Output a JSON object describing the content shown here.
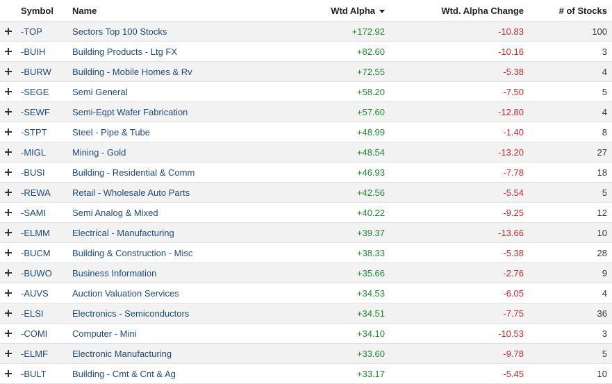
{
  "columns": {
    "symbol": "Symbol",
    "name": "Name",
    "wtd_alpha": "Wtd Alpha",
    "alpha_change": "Wtd. Alpha Change",
    "num_stocks": "# of Stocks"
  },
  "sort_icon": "sort-descending-icon",
  "colors": {
    "positive": "#1e8a2e",
    "negative": "#c62828",
    "link": "#1e4a7a",
    "row_alt": "#f2f2f2"
  },
  "rows": [
    {
      "symbol": "-TOP",
      "name": "Sectors Top 100 Stocks",
      "wtd_alpha": "+172.92",
      "alpha_change": "-10.83",
      "num_stocks": "100"
    },
    {
      "symbol": "-BUIH",
      "name": "Building Products - Ltg FX",
      "wtd_alpha": "+82.60",
      "alpha_change": "-10.16",
      "num_stocks": "3"
    },
    {
      "symbol": "-BURW",
      "name": "Building - Mobile Homes & Rv",
      "wtd_alpha": "+72.55",
      "alpha_change": "-5.38",
      "num_stocks": "4"
    },
    {
      "symbol": "-SEGE",
      "name": "Semi General",
      "wtd_alpha": "+58.20",
      "alpha_change": "-7.50",
      "num_stocks": "5"
    },
    {
      "symbol": "-SEWF",
      "name": "Semi-Eqpt Wafer Fabrication",
      "wtd_alpha": "+57.60",
      "alpha_change": "-12.80",
      "num_stocks": "4"
    },
    {
      "symbol": "-STPT",
      "name": "Steel - Pipe & Tube",
      "wtd_alpha": "+48.99",
      "alpha_change": "-1.40",
      "num_stocks": "8"
    },
    {
      "symbol": "-MIGL",
      "name": "Mining - Gold",
      "wtd_alpha": "+48.54",
      "alpha_change": "-13.20",
      "num_stocks": "27"
    },
    {
      "symbol": "-BUSI",
      "name": "Building - Residential & Comm",
      "wtd_alpha": "+46.93",
      "alpha_change": "-7.78",
      "num_stocks": "18"
    },
    {
      "symbol": "-REWA",
      "name": "Retail - Wholesale Auto Parts",
      "wtd_alpha": "+42.56",
      "alpha_change": "-5.54",
      "num_stocks": "5"
    },
    {
      "symbol": "-SAMI",
      "name": "Semi Analog & Mixed",
      "wtd_alpha": "+40.22",
      "alpha_change": "-9.25",
      "num_stocks": "12"
    },
    {
      "symbol": "-ELMM",
      "name": "Electrical - Manufacturing",
      "wtd_alpha": "+39.37",
      "alpha_change": "-13.66",
      "num_stocks": "10"
    },
    {
      "symbol": "-BUCM",
      "name": "Building & Construction - Misc",
      "wtd_alpha": "+38.33",
      "alpha_change": "-5.38",
      "num_stocks": "28"
    },
    {
      "symbol": "-BUWO",
      "name": "Business Information",
      "wtd_alpha": "+35.66",
      "alpha_change": "-2.76",
      "num_stocks": "9"
    },
    {
      "symbol": "-AUVS",
      "name": "Auction Valuation Services",
      "wtd_alpha": "+34.53",
      "alpha_change": "-6.05",
      "num_stocks": "4"
    },
    {
      "symbol": "-ELSI",
      "name": "Electronics - Semiconductors",
      "wtd_alpha": "+34.51",
      "alpha_change": "-7.75",
      "num_stocks": "36"
    },
    {
      "symbol": "-COMI",
      "name": "Computer - Mini",
      "wtd_alpha": "+34.10",
      "alpha_change": "-10.53",
      "num_stocks": "3"
    },
    {
      "symbol": "-ELMF",
      "name": "Electronic Manufacturing",
      "wtd_alpha": "+33.60",
      "alpha_change": "-9.78",
      "num_stocks": "5"
    },
    {
      "symbol": "-BULT",
      "name": "Building - Cmt & Cnt & Ag",
      "wtd_alpha": "+33.17",
      "alpha_change": "-5.45",
      "num_stocks": "10"
    }
  ]
}
